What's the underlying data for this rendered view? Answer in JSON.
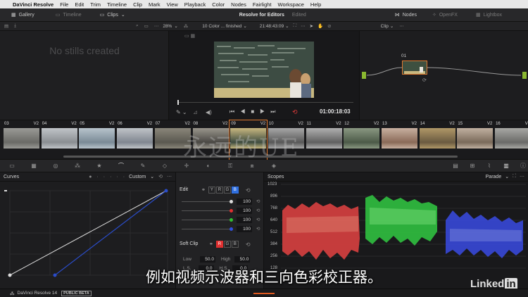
{
  "menubar": {
    "apple": "",
    "app": "DaVinci Resolve",
    "items": [
      "File",
      "Edit",
      "Trim",
      "Timeline",
      "Clip",
      "Mark",
      "View",
      "Playback",
      "Color",
      "Nodes",
      "Fairlight",
      "Workspace",
      "Help"
    ]
  },
  "toolbar": {
    "gallery": "Gallery",
    "timeline": "Timeline",
    "clips": "Clips",
    "project": "Resolve for Editors",
    "status": "Edited",
    "nodes": "Nodes",
    "openfx": "OpenFX",
    "lightbox": "Lightbox"
  },
  "viewer_header": {
    "zoom": "28%",
    "clip_name": "10 Color ... finished",
    "timecode": "21:48:43:09",
    "mode": "Clip"
  },
  "gallery": {
    "empty_text": "No stills created"
  },
  "viewer": {
    "timecode": "01:00:18:03"
  },
  "nodes": {
    "node_label": "01"
  },
  "clips": [
    {
      "num": "03",
      "track": "V2"
    },
    {
      "num": "04",
      "track": "V2"
    },
    {
      "num": "05",
      "track": "V2"
    },
    {
      "num": "06",
      "track": "V2"
    },
    {
      "num": "07",
      "track": "V2"
    },
    {
      "num": "08",
      "track": "V2"
    },
    {
      "num": "09",
      "track": "V2"
    },
    {
      "num": "10",
      "track": "V2"
    },
    {
      "num": "11",
      "track": "V2"
    },
    {
      "num": "12",
      "track": "V2"
    },
    {
      "num": "13",
      "track": "V2"
    },
    {
      "num": "14",
      "track": "V2"
    },
    {
      "num": "15",
      "track": "V2"
    },
    {
      "num": "16",
      "track": "V2"
    }
  ],
  "curves": {
    "title": "Curves",
    "mode": "Custom"
  },
  "edit": {
    "title": "Edit",
    "channels": [
      "Y",
      "R",
      "G",
      "B"
    ],
    "values": [
      "100",
      "100",
      "100",
      "100"
    ],
    "soft_clip": "Soft Clip",
    "soft_channels": [
      "R",
      "G",
      "B"
    ],
    "low_label": "Low",
    "low_value": "50.0",
    "high_label": "High",
    "high_value": "50.0",
    "ls_label": "L.S.",
    "ls_value": "0.0",
    "hs_label": "H.S.",
    "hs_value": "0.0"
  },
  "scopes": {
    "title": "Scopes",
    "mode": "Parade",
    "ticks": [
      "1023",
      "896",
      "768",
      "640",
      "512",
      "384",
      "256",
      "128"
    ]
  },
  "bottom": {
    "app": "DaVinci Resolve 14",
    "badge": "PUBLIC BETA"
  },
  "subtitle": "例如视频示波器和三向色彩校正器。",
  "watermark": "永远的UE",
  "brand": {
    "linked": "Linked",
    "in": "in"
  },
  "colors": {
    "accent": "#2f6fe0",
    "record": "#e03a3a",
    "red": "#e03030",
    "green": "#30c030",
    "blue": "#3050e0"
  }
}
